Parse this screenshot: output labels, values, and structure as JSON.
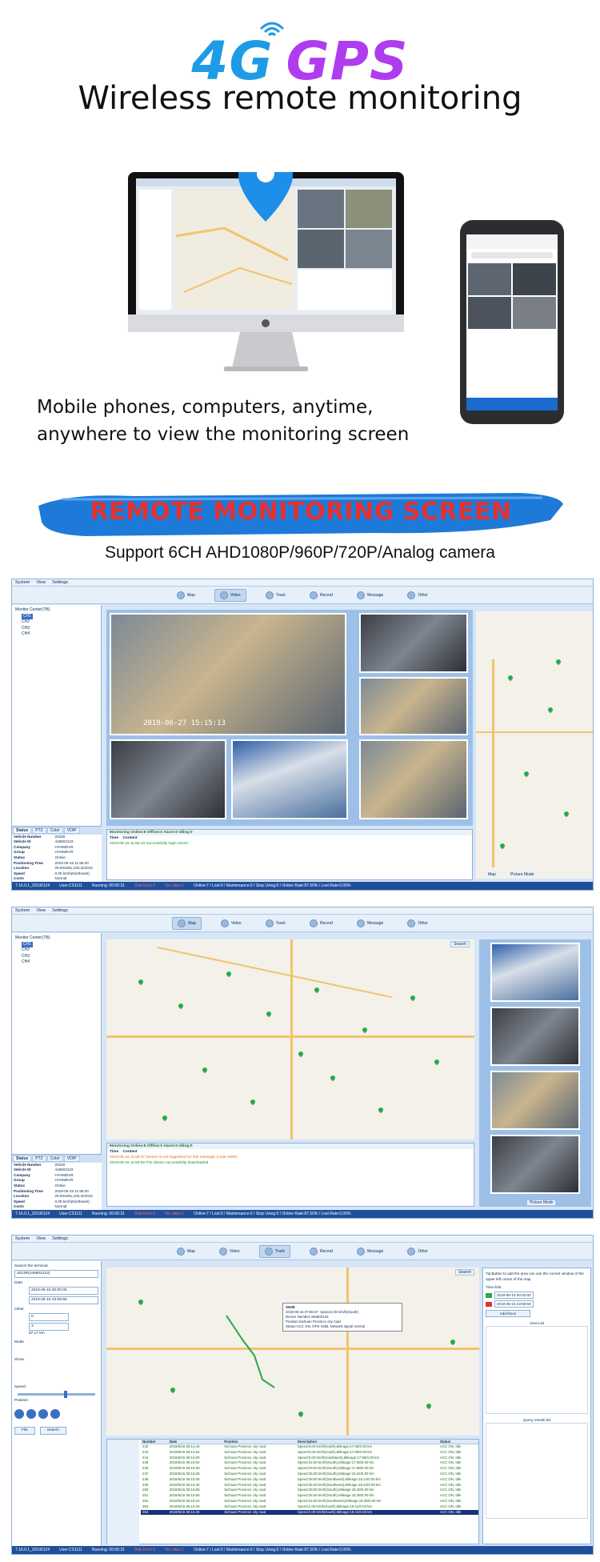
{
  "hero": {
    "title_4g": "4G",
    "title_gps": "GPS",
    "subtitle": "Wireless remote monitoring",
    "caption_line1": "Mobile phones, computers, anytime,",
    "caption_line2": "anywhere to view the monitoring screen"
  },
  "banner": {
    "title": "REMOTE MONITORING SCREEN",
    "support": "Support 6CH AHD1080P/960P/720P/Analog camera"
  },
  "colors": {
    "brand_blue": "#1e9be6",
    "brand_purple": "#b03cf0",
    "banner_red": "#e53030",
    "banner_blue": "#1e7ad8"
  },
  "app": {
    "menu": [
      "System",
      "View",
      "Settings"
    ],
    "toolbar": [
      "Map",
      "Video",
      "Track",
      "Record",
      "Message",
      "Other"
    ],
    "tree": [
      "Monitor Center(7/8)",
      "CH1",
      "CH2",
      "CH3",
      "CH4"
    ],
    "info_tabs": [
      "Status",
      "PTZ",
      "Color",
      "VOIP"
    ],
    "info_rows": [
      [
        "Vehicle Number",
        "20155"
      ],
      [
        "Vehicle ID",
        "446803133"
      ],
      [
        "Company",
        "HYHMDVR"
      ],
      [
        "Group",
        "HYHMDVR"
      ],
      [
        "Status",
        "Online"
      ],
      [
        "Positioning Time",
        "2019-06-15 11:58:20"
      ],
      [
        "Location",
        "29.003491,105.323018"
      ],
      [
        "Speed",
        "0.00 km/h(Northeast)"
      ],
      [
        "Costs",
        "Normal"
      ]
    ],
    "status": {
      "version": "7.16.0.1_20190124",
      "user": "User:CS1111",
      "running": "Running: 00:00:31",
      "disk_error": "Disk Error:0",
      "no_video": "No video:1",
      "online": "Online:7 / Lost:0 / Maintenance:0 / Stop Using:0 / Online Rate:87.50% / Lost Rate:0.00%"
    },
    "log": {
      "header": "Monitoring  Online:8  Offline:0  Alarm:0  Idling:0",
      "col_time": "Time",
      "col_content": "Content",
      "entry": "2019-06-15 11:58:10  Successfully login server",
      "warn": "2019-06-15 11:58:37  Device is not supported for this message (code:1680)",
      "ok2": "2019-06-15 11:58:52  The device successfully downloaded"
    },
    "osd": "2019-06-27 15:15:13",
    "map_label": "Map",
    "picture_label": "Picture Mode",
    "search_label": "Search"
  },
  "track": {
    "search_terminal": "Search the terminal",
    "terminal": "2013R(446803133)",
    "date_label": "Date",
    "start_time": "2019-06-15  00:00:00",
    "end_time": "2019-06-15  23:59:59",
    "other": "Other",
    "spacing": "0",
    "parking": "3",
    "mileage": "97.17 km",
    "mode": "Mode",
    "show": "Show",
    "play_label": "Speed",
    "position": "Position",
    "filter_btn": "File",
    "search_btn": "Search",
    "tip": "Tip:Button to add the area can use the current window of the upper left corner of the map",
    "time_limit": "Time limit",
    "area_list": "Area List",
    "query_results": "Query results list",
    "add_fence": "Add fence",
    "columns": [
      "Number",
      "Date",
      "Position",
      "Description",
      "Status"
    ],
    "rows": [
      [
        "242",
        "2019/6/15 06:14:44",
        "Sichuan Province city road",
        "Speed:0.00 km/h(South),Mileage:17.95/0.00 km",
        "ACC ON, Idle"
      ],
      [
        "243",
        "2019/6/15 06:14:54",
        "Sichuan Province city road",
        "Speed:0.00 km/h(South),Mileage:17.95/0.00 km",
        "ACC ON, Idle"
      ],
      [
        "244",
        "2019/6/15 06:15:00",
        "Sichuan Province city road",
        "Speed:5.00 km/h(Southwest),Mileage:17.95/0.00 km",
        "ACC ON, Idle"
      ],
      [
        "245",
        "2019/6/15 06:15:04",
        "Sichuan Province city road",
        "Speed:22.00 km/h(South),Mileage:17.96/0.00 km",
        "ACC ON, Idle"
      ],
      [
        "246",
        "2019/6/15 06:15:20",
        "Sichuan Province city road",
        "Speed:29.00 km/h(South),Mileage:17.99/0.00 km",
        "ACC ON, Idle"
      ],
      [
        "247",
        "2019/6/15 06:15:26",
        "Sichuan Province city road",
        "Speed:36.00 km/h(South),Mileage:18.04/0.00 km",
        "ACC ON, Idle"
      ],
      [
        "248",
        "2019/6/15 06:15:36",
        "Sichuan Province city road",
        "Speed:38.00 km/h(Southeast),Mileage:18.14/0.00 km",
        "ACC ON, Idle"
      ],
      [
        "249",
        "2019/6/15 06:15:46",
        "Sichuan Province city road",
        "Speed:36.00 km/h(Southeast),Mileage:18.23/0.00 km",
        "ACC ON, Idle"
      ],
      [
        "250",
        "2019/6/15 06:15:56",
        "Sichuan Province city road",
        "Speed:38.00 km/h(South),Mileage:18.30/0.00 km",
        "ACC ON, Idle"
      ],
      [
        "251",
        "2019/6/15 06:16:06",
        "Sichuan Province city road",
        "Speed:35.00 km/h(South),Mileage:18.36/0.00 km",
        "ACC ON, Idle"
      ],
      [
        "252",
        "2019/6/15 06:16:16",
        "Sichuan Province city road",
        "Speed:34.00 km/h(Southwest),Mileage:18.39/0.00 km",
        "ACC ON, Idle"
      ],
      [
        "253",
        "2019/6/15 06:16:26",
        "Sichuan Province city road",
        "Speed:2.00 km/h(South),Mileage:18.41/0.00 km",
        "ACC ON, Idle"
      ],
      [
        "254",
        "2019/6/15 06:16:45",
        "Sichuan Province city road",
        "Speed:2.00 km/h(South),Mileage:18.41/0.00 km",
        "ACC ON, Idle"
      ]
    ],
    "popup": {
      "title": "SN2B",
      "time": "2019-06-15 07:56:37",
      "speed": "Speed:2.00 km/h(South)",
      "device": "Device Number:446803133",
      "position": "Position:Sichuan Province city road",
      "status": "Status:ACC ON, GPS Valid, Network signal normal"
    }
  }
}
